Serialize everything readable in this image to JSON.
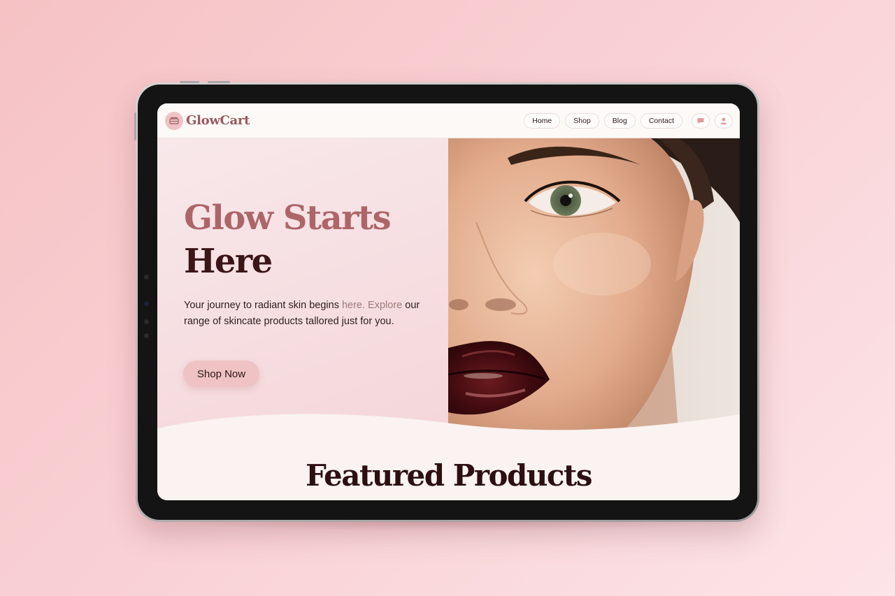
{
  "brand": {
    "name": "GlowCart",
    "accent": "#efc3c3",
    "logo_color": "#9a5a5e"
  },
  "nav": {
    "links": [
      "Home",
      "Shop",
      "Blog",
      "Contact"
    ],
    "icons": [
      "chat-icon",
      "user-icon"
    ]
  },
  "hero": {
    "title_line1": "Glow Starts",
    "title_line2": "Here",
    "description_main": "Your journey to radiant skin begins ",
    "description_light": "here. Explore",
    "description_rest": "our range of skincate products tallored just for you.",
    "cta": "Shop Now",
    "image": "woman-face-dark-lipstick"
  },
  "section": {
    "title": "Featured Products"
  }
}
